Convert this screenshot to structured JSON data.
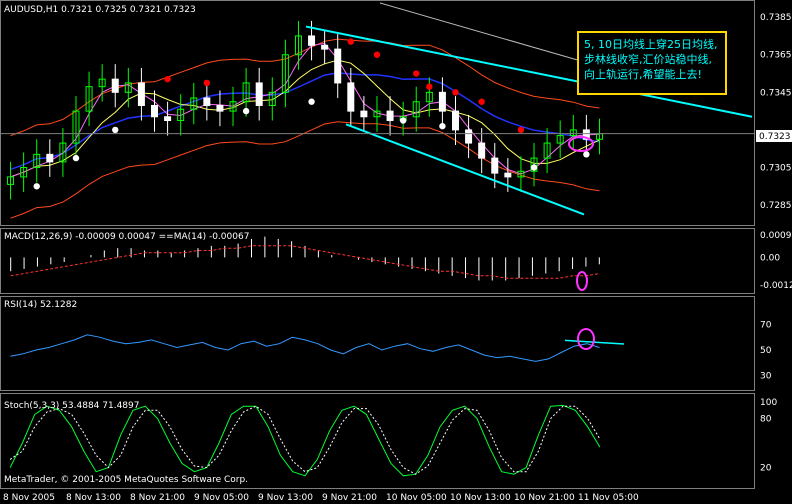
{
  "header": {
    "symbol_line": "AUDUSD,H1  0.7321  0.7325  0.7321  0.7323"
  },
  "annotation": "5, 10日均线上穿25日均线,步林线收窄,汇价站稳中线,向上轨运行,希望能上去!",
  "indicators": {
    "macd_label": "MACD(12,26,9) -0.00009 0.00047  ==MA(14) -0.00067",
    "rsi_label": "RSI(14) 52.1282",
    "stoch_label": "Stoch(5,3,3) 53.4884 71.4897"
  },
  "copyright": "MetaTrader, © 2001-2005 MetaQuotes Software Corp.",
  "current_price": "0.7323",
  "colors": {
    "background": "#000000",
    "bull_candle": "#00ff00",
    "bear_candle": "#ffffff",
    "channel": "#00ffff",
    "bollinger": "#ff4a1a",
    "ma_blue": "#2233ff",
    "sar_red": "#ff0000",
    "sar_white": "#ffffff",
    "ellipse": "#ff33ff",
    "annotation_border": "#ffd700"
  },
  "chart_data": [
    {
      "type": "candlestick",
      "title": "AUDUSD,H1",
      "yticks": [
        "0.7385",
        "0.7365",
        "0.7345",
        "0.7323",
        "0.7305",
        "0.7285"
      ],
      "ylim": [
        0.7276,
        0.7392
      ],
      "xticks": [
        "8 Nov 2005",
        "8 Nov 13:00",
        "8 Nov 21:00",
        "9 Nov 05:00",
        "9 Nov 13:00",
        "9 Nov 21:00",
        "10 Nov 05:00",
        "10 Nov 13:00",
        "10 Nov 21:00",
        "11 Nov 05:00"
      ],
      "close": [
        0.73,
        0.7305,
        0.7312,
        0.7308,
        0.7318,
        0.7335,
        0.7348,
        0.7352,
        0.7345,
        0.735,
        0.7338,
        0.7332,
        0.733,
        0.7336,
        0.7342,
        0.7338,
        0.7335,
        0.734,
        0.735,
        0.7338,
        0.7345,
        0.7365,
        0.7375,
        0.737,
        0.7368,
        0.735,
        0.7335,
        0.7332,
        0.7335,
        0.733,
        0.7332,
        0.734,
        0.7345,
        0.7335,
        0.7325,
        0.7318,
        0.731,
        0.7302,
        0.73,
        0.7303,
        0.731,
        0.7318,
        0.7322,
        0.7325,
        0.732,
        0.7323
      ],
      "sar_red": [
        [
          12,
          0.7352
        ],
        [
          15,
          0.735
        ],
        [
          26,
          0.7372
        ],
        [
          28,
          0.7365
        ],
        [
          31,
          0.7355
        ],
        [
          32,
          0.7348
        ],
        [
          34,
          0.7345
        ],
        [
          36,
          0.734
        ],
        [
          39,
          0.7325
        ]
      ],
      "sar_white": [
        [
          2,
          0.7295
        ],
        [
          5,
          0.731
        ],
        [
          8,
          0.7325
        ],
        [
          18,
          0.7335
        ],
        [
          23,
          0.734
        ],
        [
          30,
          0.733
        ],
        [
          33,
          0.7327
        ],
        [
          40,
          0.7305
        ],
        [
          44,
          0.7312
        ]
      ],
      "channel_upper": [
        [
          0.738
        ],
        [
          0.7332
        ]
      ],
      "channel_lower": [
        [
          0.7328
        ],
        [
          0.728
        ]
      ]
    },
    {
      "type": "bar",
      "title": "MACD(12,26,9)",
      "yticks": [
        "0.00096",
        "0.00",
        "-0.0012"
      ],
      "ylim": [
        -0.0015,
        0.0011
      ],
      "values": [
        -0.0006,
        -0.0005,
        -0.0004,
        -0.0003,
        -0.0002,
        0.0,
        0.0001,
        0.0003,
        0.0004,
        0.0004,
        0.0003,
        0.0003,
        0.0002,
        0.0003,
        0.0004,
        0.0005,
        0.0005,
        0.0006,
        0.0008,
        0.0009,
        0.0008,
        0.0007,
        0.0005,
        0.0003,
        0.0001,
        0.0,
        -0.0001,
        -0.0002,
        -0.0003,
        -0.0004,
        -0.0005,
        -0.0006,
        -0.0007,
        -0.0008,
        -0.0009,
        -0.001,
        -0.001,
        -0.001,
        -0.0009,
        -0.0008,
        -0.0007,
        -0.0006,
        -0.0005,
        -0.0004,
        -0.0003
      ],
      "signal": [
        -0.0008,
        -0.0007,
        -0.0006,
        -0.0005,
        -0.0004,
        -0.0003,
        -0.0002,
        -0.0001,
        0.0,
        0.0001,
        0.0002,
        0.0002,
        0.0002,
        0.0002,
        0.0003,
        0.0003,
        0.0004,
        0.0004,
        0.0005,
        0.0005,
        0.0005,
        0.0005,
        0.0004,
        0.0003,
        0.0002,
        0.0001,
        0.0,
        -0.0001,
        -0.0002,
        -0.0003,
        -0.0004,
        -0.0005,
        -0.0006,
        -0.0006,
        -0.0007,
        -0.0008,
        -0.0008,
        -0.0009,
        -0.0009,
        -0.0009,
        -0.0009,
        -0.0009,
        -0.0008,
        -0.0008,
        -0.0007
      ]
    },
    {
      "type": "line",
      "title": "RSI(14)",
      "yticks": [
        "70",
        "50",
        "30"
      ],
      "ylim": [
        20,
        80
      ],
      "values": [
        45,
        47,
        50,
        52,
        55,
        58,
        62,
        60,
        57,
        55,
        56,
        58,
        55,
        52,
        54,
        56,
        52,
        50,
        55,
        57,
        53,
        55,
        60,
        58,
        55,
        50,
        47,
        52,
        55,
        50,
        53,
        55,
        51,
        49,
        52,
        54,
        50,
        46,
        44,
        45,
        43,
        41,
        43,
        48,
        53,
        55,
        52
      ],
      "trend_line": [
        [
          41,
          56
        ],
        [
          44,
          50
        ]
      ]
    },
    {
      "type": "line",
      "title": "Stoch(5,3,3)",
      "yticks": [
        "100",
        "80",
        "20"
      ],
      "ylim": [
        0,
        105
      ],
      "k": [
        20,
        50,
        85,
        95,
        90,
        70,
        40,
        15,
        20,
        60,
        90,
        95,
        80,
        50,
        25,
        15,
        20,
        50,
        85,
        95,
        95,
        70,
        35,
        15,
        10,
        30,
        65,
        90,
        95,
        85,
        55,
        25,
        10,
        12,
        35,
        70,
        90,
        95,
        80,
        45,
        15,
        12,
        20,
        60,
        95,
        96,
        90,
        70,
        45
      ],
      "d": [
        30,
        40,
        70,
        88,
        92,
        85,
        62,
        35,
        20,
        35,
        70,
        90,
        90,
        70,
        42,
        22,
        20,
        35,
        65,
        88,
        95,
        85,
        55,
        28,
        15,
        20,
        45,
        75,
        92,
        92,
        72,
        42,
        20,
        12,
        22,
        50,
        78,
        92,
        90,
        65,
        32,
        15,
        15,
        40,
        80,
        95,
        95,
        80,
        55
      ]
    }
  ]
}
